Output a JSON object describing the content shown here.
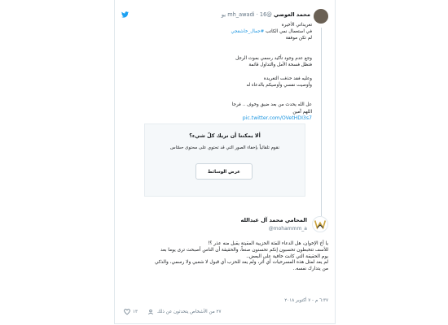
{
  "colors": {
    "accent": "#1b95e0",
    "text": "#14171a",
    "muted": "#657786",
    "border": "#e1e8ed"
  },
  "icons": [
    "twitter-bird-icon",
    "heart-icon",
    "people-icon"
  ],
  "tweet1": {
    "name": "محمد العوضي",
    "handle": "@mh_awadi",
    "time": "16 يو",
    "lines": [
      "تغريداتي الأخيرة",
      "في استعمال نمي الكاتب #جمال_خاشقجي",
      "لم تكن موفقة",
      "",
      "",
      "وجع عدم وجود تأكيد رسمي بموت الرجل",
      "فتظل فسحة الأمل والتداول قائمة",
      "",
      "وعليه فقد حذفت التغريدة",
      "وأوصيت نفسي وأوصيكم بالدعاء له",
      "",
      "",
      "عل الله يحدث من بعد ضيق وخوف .. فرجا",
      "اللهم آمين"
    ],
    "link": "pic.twitter.com/OVetHDI3s7",
    "sensitive": {
      "title": "ألا يمكننا أن نريك كلّ شيء؟",
      "desc": "نقوم تلقائياً بإخفاء الصور التي قد تحتوي على محتوى حسّاس",
      "button": "عرض الوسائط"
    }
  },
  "tweet2": {
    "name": "المحامي محمد آل عبدالله",
    "handle": "@mohammm_a",
    "lines": [
      "يا أخ الإخوان، هل الدعاء للفئة الحزبية المقيتة يقبل منه عذر ؟!",
      "للأسف تتخبطون تحسبون إنكم تحسنون صنعاً، والحقيقة أن الناس أصبحت ترى يوما بعد",
      "يوم الحقيقة التي كانت خافية على البعض..",
      "لم يعد لمثل هذه المسرحيات أي أثر، ولم يعد للحزب أي قبول لا شعبي ولا رسمي، والذكي",
      "من يتدارك نفسه.."
    ],
    "timestamp": "٦:٣٧ م - ٧ أكتوبر ٢٠١٨",
    "likes": "١٣",
    "people": "٢٧ من الأشخاص يتحدثون عن ذلك"
  }
}
